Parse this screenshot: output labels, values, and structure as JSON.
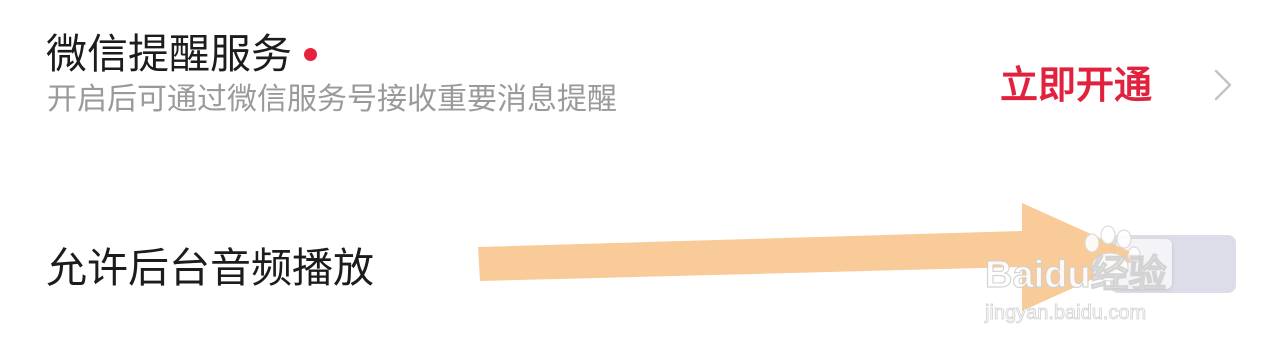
{
  "settings": {
    "wechat_reminder": {
      "title": "微信提醒服务",
      "subtitle": "开启后可通过微信服务号接收重要消息提醒",
      "action_label": "立即开通",
      "action_color": "#e0223f",
      "indicator_color": "#e8213f",
      "chevron_icon": "chevron-right-icon"
    },
    "background_audio": {
      "title": "允许后台音频播放",
      "toggle_on": false
    }
  },
  "annotation": {
    "arrow_color": "#f7c790",
    "arrow_icon": "arrow-right-icon"
  },
  "watermark": {
    "text": "Baidu经验",
    "url_text": "jingyan.baidu.com"
  }
}
